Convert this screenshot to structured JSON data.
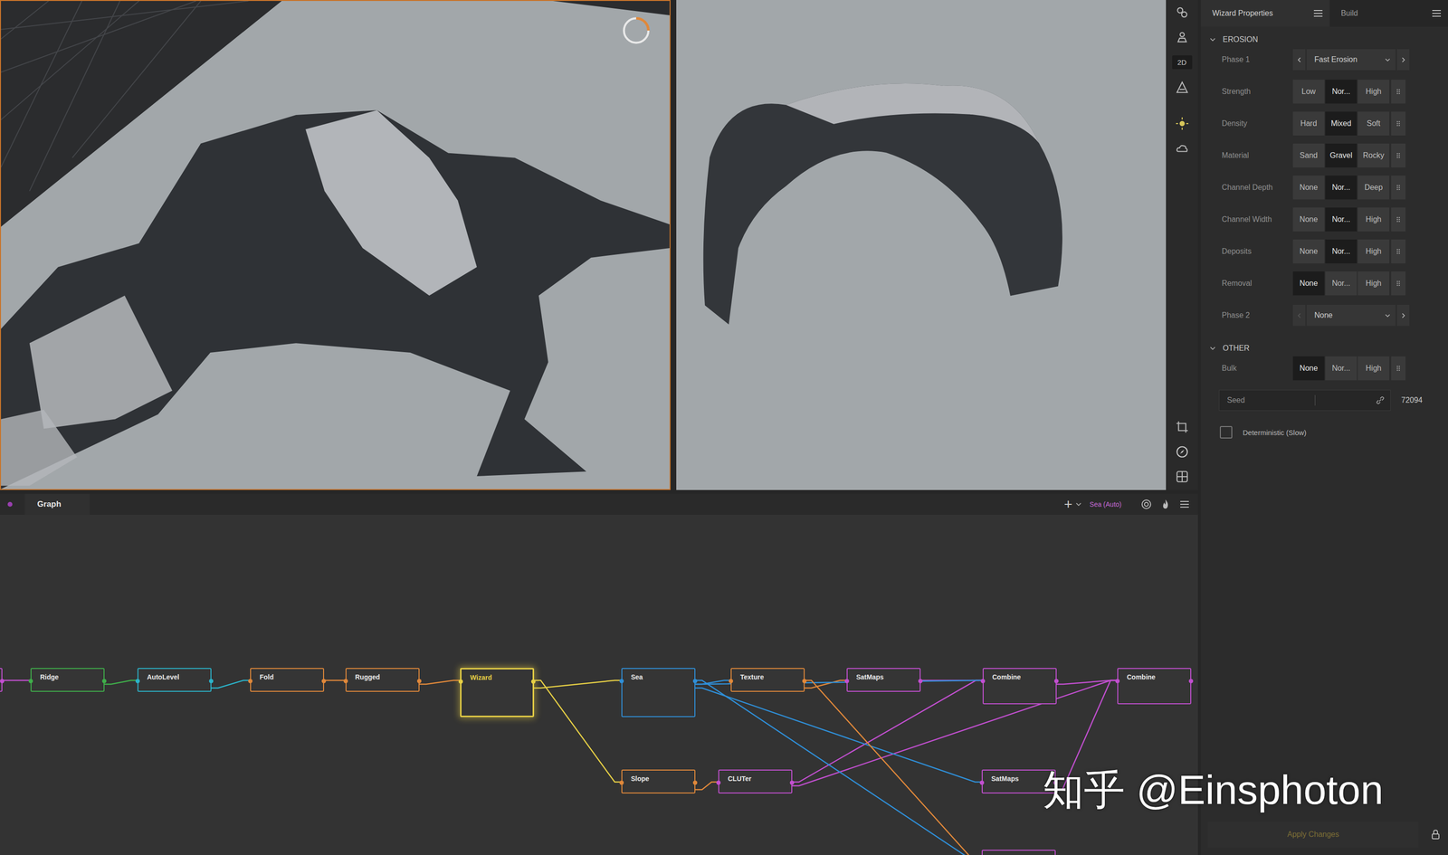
{
  "viewports": [
    {
      "selected": true,
      "loading": true
    },
    {
      "selected": false,
      "loading": false
    }
  ],
  "toolbar": {
    "mode": "2D"
  },
  "graph": {
    "tab": "Graph",
    "add": "+",
    "target": "Sea (Auto)",
    "nodes": [
      {
        "label": "Ridge",
        "color": "#3fae4a",
        "selected": false
      },
      {
        "label": "AutoLevel",
        "color": "#2bb3c9",
        "selected": false
      },
      {
        "label": "Fold",
        "color": "#e0883a",
        "selected": false
      },
      {
        "label": "Rugged",
        "color": "#e0883a",
        "selected": false
      },
      {
        "label": "Wizard",
        "color": "#e6cf45",
        "selected": true
      },
      {
        "label": "Sea",
        "color": "#2f8fd8",
        "selected": false
      },
      {
        "label": "Texture",
        "color": "#e0883a",
        "selected": false
      },
      {
        "label": "SatMaps",
        "color": "#c24fd0",
        "selected": false
      },
      {
        "label": "Combine",
        "color": "#c24fd0",
        "selected": false
      },
      {
        "label": "Combine",
        "color": "#c24fd0",
        "selected": false
      },
      {
        "label": "Slope",
        "color": "#e0883a",
        "selected": false
      },
      {
        "label": "CLUTer",
        "color": "#c24fd0",
        "selected": false
      },
      {
        "label": "SatMaps",
        "color": "#c24fd0",
        "selected": false
      },
      {
        "label": "",
        "color": "#c24fd0",
        "selected": false
      },
      {
        "label": "",
        "color": "#c24fd0",
        "selected": false
      }
    ],
    "edges": [
      [
        14,
        0
      ],
      [
        0,
        1
      ],
      [
        1,
        2
      ],
      [
        2,
        3
      ],
      [
        3,
        4
      ],
      [
        4,
        5
      ],
      [
        4,
        10
      ],
      [
        5,
        6
      ],
      [
        6,
        7
      ],
      [
        7,
        8
      ],
      [
        8,
        9
      ],
      [
        10,
        11
      ],
      [
        11,
        8
      ],
      [
        11,
        9
      ],
      [
        5,
        12
      ],
      [
        5,
        13
      ],
      [
        5,
        8
      ],
      [
        12,
        9
      ],
      [
        6,
        13
      ]
    ]
  },
  "properties": {
    "tabs": [
      {
        "label": "Wizard Properties",
        "selected": true
      },
      {
        "label": "Build",
        "selected": false
      }
    ],
    "sections": [
      {
        "title": "EROSION",
        "expanded": true,
        "rows": [
          {
            "kind": "dropdown",
            "label": "Phase 1",
            "value": "Fast Erosion",
            "prev_disabled": false,
            "next_disabled": false
          },
          {
            "kind": "segmented",
            "label": "Strength",
            "options": [
              {
                "label": "Low",
                "selected": false
              },
              {
                "label": "Nor...",
                "selected": true
              },
              {
                "label": "High",
                "selected": false
              }
            ]
          },
          {
            "kind": "segmented",
            "label": "Density",
            "options": [
              {
                "label": "Hard",
                "selected": false
              },
              {
                "label": "Mixed",
                "selected": true
              },
              {
                "label": "Soft",
                "selected": false
              }
            ]
          },
          {
            "kind": "segmented",
            "label": "Material",
            "options": [
              {
                "label": "Sand",
                "selected": false
              },
              {
                "label": "Gravel",
                "selected": true
              },
              {
                "label": "Rocky",
                "selected": false
              }
            ]
          },
          {
            "kind": "segmented",
            "label": "Channel Depth",
            "options": [
              {
                "label": "None",
                "selected": false
              },
              {
                "label": "Nor...",
                "selected": true
              },
              {
                "label": "Deep",
                "selected": false
              }
            ]
          },
          {
            "kind": "segmented",
            "label": "Channel Width",
            "options": [
              {
                "label": "None",
                "selected": false
              },
              {
                "label": "Nor...",
                "selected": true
              },
              {
                "label": "High",
                "selected": false
              }
            ]
          },
          {
            "kind": "segmented",
            "label": "Deposits",
            "options": [
              {
                "label": "None",
                "selected": false
              },
              {
                "label": "Nor...",
                "selected": true
              },
              {
                "label": "High",
                "selected": false
              }
            ]
          },
          {
            "kind": "segmented",
            "label": "Removal",
            "options": [
              {
                "label": "None",
                "selected": true
              },
              {
                "label": "Nor...",
                "selected": false
              },
              {
                "label": "High",
                "selected": false
              }
            ]
          },
          {
            "kind": "dropdown",
            "label": "Phase 2",
            "value": "None",
            "prev_disabled": true,
            "next_disabled": false
          }
        ]
      },
      {
        "title": "OTHER",
        "expanded": true,
        "rows": [
          {
            "kind": "segmented",
            "label": "Bulk",
            "options": [
              {
                "label": "None",
                "selected": true
              },
              {
                "label": "Nor...",
                "selected": false
              },
              {
                "label": "High",
                "selected": false
              }
            ]
          },
          {
            "kind": "seed",
            "label": "Seed",
            "value": "72094"
          },
          {
            "kind": "checkbox",
            "label": "Deterministic (Slow)",
            "checked": false
          }
        ]
      }
    ],
    "apply": {
      "label": "Apply Changes",
      "disabled": true
    }
  },
  "watermark": "知乎 @Einsphoton"
}
